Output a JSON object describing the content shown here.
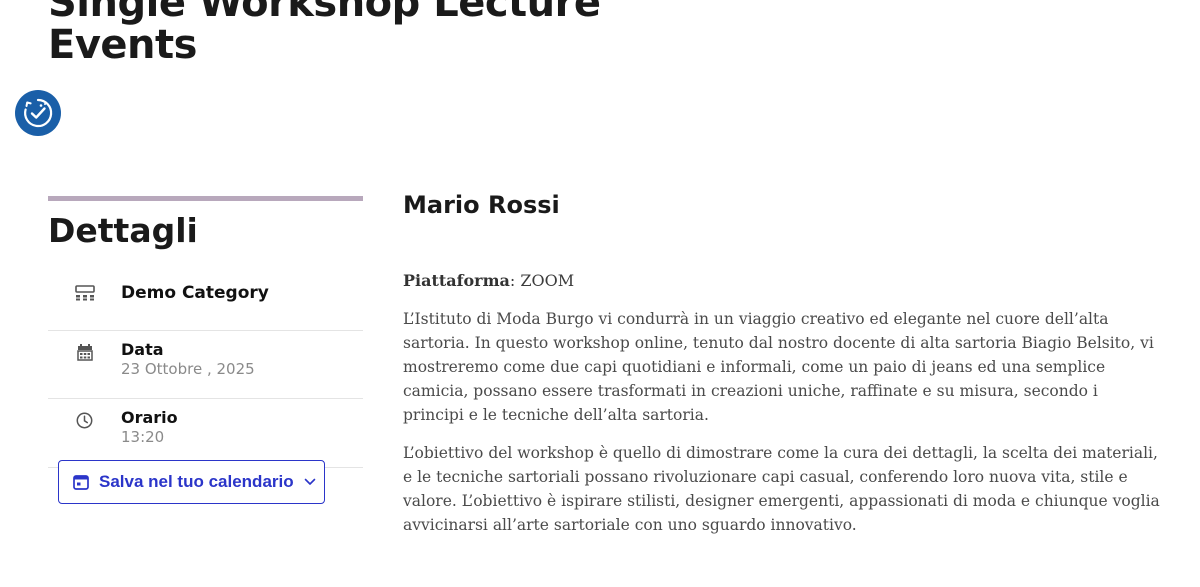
{
  "page": {
    "title": "Single Workshop Lecture Events"
  },
  "accessibility": {
    "icon": "accessibility-check-icon",
    "color": "#1a5fa8"
  },
  "sidebar": {
    "heading": "Dettagli",
    "category": {
      "icon": "category-icon",
      "label": "Demo Category"
    },
    "date": {
      "icon": "calendar-icon",
      "title": "Data",
      "value": "23 Ottobre , 2025"
    },
    "time": {
      "icon": "clock-icon",
      "title": "Orario",
      "value": "13:20"
    },
    "calendar_button": {
      "icon": "calendar-add-icon",
      "label": "Salva nel tuo calendario",
      "chevron": "chevron-down-icon",
      "color": "#2b35c9"
    },
    "accent_color": "#b8a8bc"
  },
  "main": {
    "speaker": "Mario Rossi",
    "platform_label": "Piattaforma",
    "platform_value": ": ZOOM",
    "paragraphs": [
      "L’Istituto di Moda Burgo vi condurrà in un viaggio creativo ed elegante nel cuore dell’alta sartoria. In questo workshop online, tenuto dal nostro docente di alta sartoria Biagio Belsito, vi mostreremo come due capi quotidiani e informali, come un paio di jeans ed una semplice camicia, possano essere trasformati in creazioni uniche, raffinate e su misura, secondo i principi e le tecniche dell’alta sartoria.",
      "L’obiettivo del workshop è quello di dimostrare come la cura dei dettagli, la scelta dei materiali, e le tecniche sartoriali possano rivoluzionare capi casual, conferendo loro nuova vita, stile e valore. L’obiettivo è ispirare stilisti, designer emergenti, appassionati di moda e chiunque voglia avvicinarsi all’arte sartoriale con uno sguardo innovativo."
    ]
  }
}
